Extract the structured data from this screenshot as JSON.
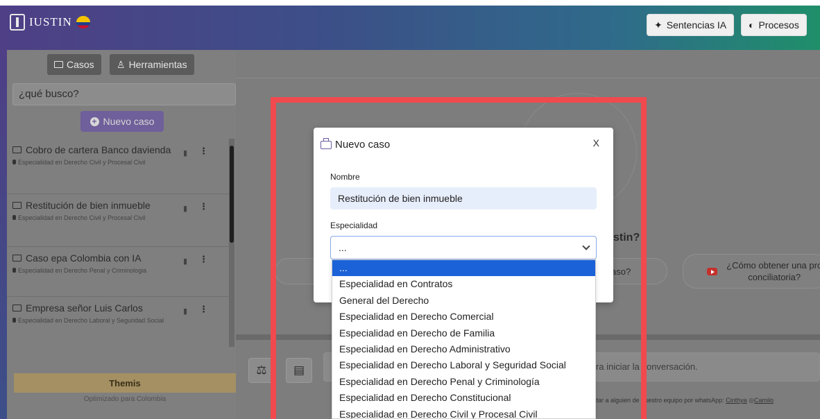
{
  "app": {
    "logo_text": "IUSTIN"
  },
  "header": {
    "sentencias_label": "Sentencias IA",
    "procesos_label": "Procesos"
  },
  "sidebar": {
    "tabs": [
      {
        "label": "Casos"
      },
      {
        "label": "Herramientas"
      }
    ],
    "search_placeholder": "¿qué busco?",
    "new_case_label": "Nuevo caso",
    "cases": [
      {
        "title": "Cobro de cartera Banco davienda",
        "spec": "Especialidad en Derecho Civil y Procesal Civil"
      },
      {
        "title": "Restitución de bien inmueble",
        "spec": "Especialidad en Derecho Civil y Procesal Civil"
      },
      {
        "title": "Caso epa Colombia con IA",
        "spec": "Especialidad en Derecho Penal y Criminologia"
      },
      {
        "title": "Empresa señor Luis Carlos",
        "spec": "Especialidad en Derecho Laboral y Seguridad Social"
      }
    ],
    "themis_label": "Themis",
    "themis_sub": "Optimizado para Colombia"
  },
  "main": {
    "question_fragment": "stin?",
    "pill_left_text": "aso?",
    "pill_right_text": "¿Cómo obtener una pro conciliatoria?",
    "chat_placeholder": "ra iniciar la conversación.",
    "footer_text": "actar a alguien de nuestro equipo por whatsApp: ",
    "footer_link1": "Cinthya",
    "footer_link2": "Camilo"
  },
  "modal": {
    "title": "Nuevo caso",
    "close": "X",
    "name_label": "Nombre",
    "name_value": "Restitución de bien inmueble",
    "spec_label": "Especialidad",
    "spec_value": "...",
    "options": [
      "...",
      "Especialidad en Contratos",
      "General del Derecho",
      "Especialidad en Derecho Comercial",
      "Especialidad en Derecho de Familia",
      "Especialidad en Derecho Administrativo",
      "Especialidad en Derecho Laboral y Seguridad Social",
      "Especialidad en Derecho Penal y Criminología",
      "Especialidad en Derecho Constitucional",
      "Especialidad en Derecho Civil y Procesal Civil"
    ]
  },
  "colors": {
    "accent": "#6b5aa0",
    "selected_option": "#1b61d8",
    "highlight_frame": "#f04a4e"
  }
}
